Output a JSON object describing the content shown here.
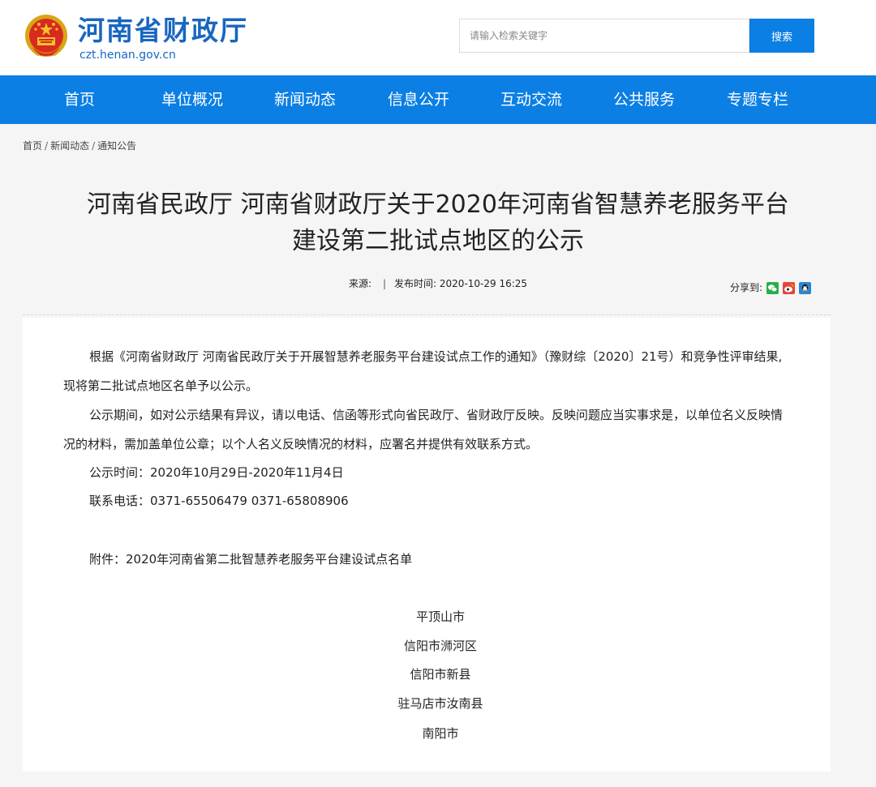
{
  "header": {
    "site_title": "河南省财政厅",
    "site_domain": "czt.henan.gov.cn",
    "search_placeholder": "请输入检索关键字",
    "search_button": "搜索"
  },
  "nav": {
    "items": [
      "首页",
      "单位概况",
      "新闻动态",
      "信息公开",
      "互动交流",
      "公共服务",
      "专题专栏"
    ]
  },
  "breadcrumb": {
    "items": [
      "首页",
      "新闻动态",
      "通知公告"
    ],
    "separator": "/"
  },
  "article": {
    "title_line1": "河南省民政厅 河南省财政厅关于2020年河南省智慧养老服务平台",
    "title_line2": "建设第二批试点地区的公示",
    "source_label": "来源:",
    "publish_label": "发布时间:",
    "publish_time": "2020-10-29 16:25",
    "share_label": "分享到:",
    "share_icons": [
      "wechat-icon",
      "weibo-icon",
      "qq-icon"
    ],
    "paragraph1": "根据《河南省财政厅 河南省民政厅关于开展智慧养老服务平台建设试点工作的通知》（豫财综〔2020〕21号）和竞争性评审结果,现将第二批试点地区名单予以公示。",
    "paragraph2": "公示期间，如对公示结果有异议，请以电话、信函等形式向省民政厅、省财政厅反映。反映问题应当实事求是，以单位名义反映情况的材料，需加盖单位公章；以个人名义反映情况的材料，应署名并提供有效联系方式。",
    "notice_period": "公示时间：2020年10月29日-2020年11月4日",
    "contact_phone": "联系电话：0371-65506479 0371-65808906",
    "attachment": "附件：2020年河南省第二批智慧养老服务平台建设试点名单",
    "pilot_areas": [
      "平顶山市",
      "信阳市浉河区",
      "信阳市新县",
      "驻马店市汝南县",
      "南阳市"
    ]
  },
  "colors": {
    "brand_blue": "#1866c0",
    "nav_blue": "#0b7fe4"
  }
}
